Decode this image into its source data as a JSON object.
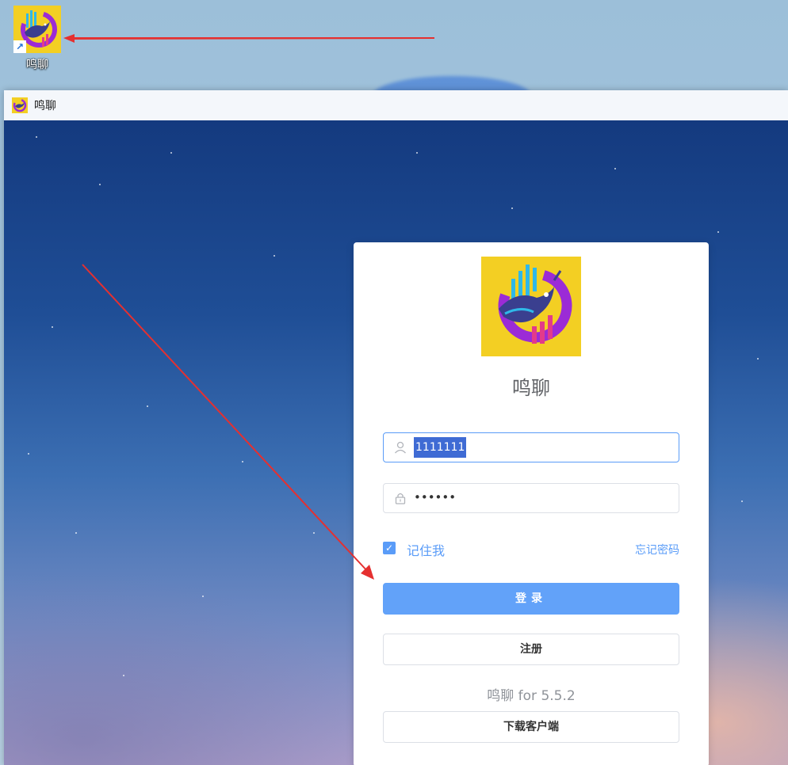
{
  "desktop": {
    "icon_label": "鸣聊",
    "shortcut_glyph": "↗"
  },
  "window": {
    "title": "鸣聊"
  },
  "login": {
    "brand": "鸣聊",
    "username_value": "1111111",
    "password_masked": "••••••",
    "remember_label": "记住我",
    "remember_checked": true,
    "forgot_label": "忘记密码",
    "login_button": "登录",
    "register_button": "注册",
    "version_text": "鸣聊 for 5.5.2",
    "download_button": "下载客户端"
  },
  "colors": {
    "accent": "#5a9cf8",
    "primary_button": "#62a2f9",
    "logo_background": "#f3cf23",
    "annotation_arrow": "#e53030"
  },
  "icons": [
    "user-icon",
    "lock-icon",
    "check-icon",
    "app-logo-icon",
    "shortcut-arrow-icon"
  ]
}
